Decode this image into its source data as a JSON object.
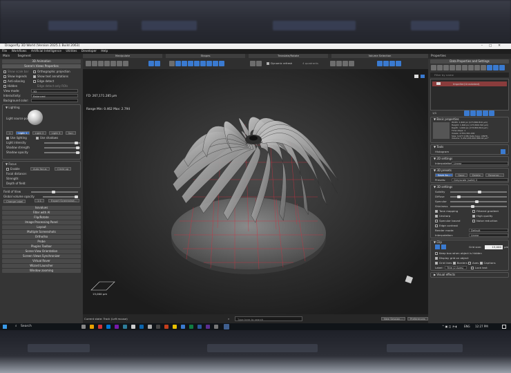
{
  "window": {
    "title": "Dragonfly 3D World (Version 2025.1 Build 2063)",
    "controls": [
      "–",
      "□",
      "✕"
    ]
  },
  "menu": [
    "File",
    "Workflows",
    "Artificial Intelligence",
    "Utilities",
    "Developer",
    "Help"
  ],
  "left_panel": {
    "tabs": [
      "Main",
      "Segment"
    ],
    "section_top": "3D Animation",
    "section_main": "Scene's Views Properties",
    "checks": [
      {
        "label": "Show scale bar",
        "on": false,
        "dim": true
      },
      {
        "label": "Orthographic projection",
        "on": false
      },
      {
        "label": "Show legends",
        "on": false
      },
      {
        "label": "Show text annotations",
        "on": true
      },
      {
        "label": "Anti-aliasing",
        "on": false
      },
      {
        "label": "Edge detect",
        "on": false
      },
      {
        "label": "Hidden",
        "on": false
      },
      {
        "label": "Edge detect only ROIs",
        "on": false,
        "dim": true
      }
    ],
    "view_mode_label": "View mode:",
    "view_mode_value": "3D",
    "interactivity_label": "Interactivity:",
    "interactivity_value": "Balanced",
    "background_color_label": "Background color:",
    "lighting": {
      "title": "Lighting",
      "light_source_label": "Light source position:",
      "light_buttons": [
        "1",
        "Light 1",
        "Light 2",
        "Light 3",
        "Sun"
      ],
      "use_lighting": "Use lighting",
      "use_shadows": "Use shadows",
      "sliders": [
        "Light intensity",
        "Shadow strength",
        "Shadow opacity"
      ]
    },
    "focus": {
      "title": "Focus",
      "enable": "Enable",
      "auto_focus": "Auto focus",
      "circle_up": "Circle up",
      "focal_distance": "Focal distance:",
      "strength": "Strength:",
      "depth_of_field": "Depth of field:"
    },
    "field_of_view": "Field of View",
    "global_volume_opacity": "Global volume opacity",
    "change_label": "Change label",
    "export_screenshot": "Export Screenshot...",
    "sections": [
      "Isovalues",
      "Filter with AI",
      "Flip/Rotate",
      "Image Processing Panel",
      "Layout",
      "Multiple Screenshots",
      "Ortho/Iso",
      "Probe",
      "Plugins Toolbar",
      "Scene View Orientation",
      "Screen Views Synchronizer",
      "Virtual Rover",
      "Wizard Launcher",
      "Window zooming"
    ]
  },
  "toolbar": {
    "groups": [
      "Manipulate",
      "Shapes",
      "Translate/Rotate",
      "Volume Selection"
    ],
    "symmetric_refresh": "Dynamic refresh",
    "quadrants": "4 quadrants"
  },
  "viewport": {
    "fd": "FD: 267,171.285 µm",
    "range": "Range Min: 0.462 Max: 2.794",
    "scale_bar": "15,000 µm"
  },
  "status": {
    "current_state": "Current state: Track (Left mouse)",
    "search_placeholder": "Type here to search",
    "new_session": "New Session...",
    "preferences": "Preferences"
  },
  "right_panel": {
    "title": "Properties",
    "section": "Data Properties and Settings",
    "filter_placeholder": "Filter by name",
    "dataset_name": "Impeller(Unrotated)",
    "count": "1/1",
    "basic_properties": "Basic properties",
    "info_lines": [
      "Width: 1,600 px (173,800.810 µm)",
      "Height: 1,600 px (173,800.310 µm)",
      "Depth: 1,600 px (173,800.810 µm)",
      "Time steps: 1",
      "Voxels: 2,554,301,000",
      "Size: 9,977.0 Mb  Data type: UINT8",
      "Volume: 5,452,003,000,486.02 µm³"
    ],
    "tools": "Tools",
    "histogram": "Histogram",
    "settings_2d": "2D settings",
    "interpolation_label": "Interpolation:",
    "interpolation_value": "Linear",
    "presets_3d": "3D presets",
    "preset_buttons": [
      "Save As...",
      "Save",
      "Delete",
      "Rename..."
    ],
    "presets_label": "Presets:",
    "presets_value": "Greyscale (solid) 2",
    "settings_3d": "3D settings",
    "solidity": "Solidity",
    "diffuse": "Diffuse",
    "specular": "Specular",
    "shininess": "Shininess",
    "checks_3d": [
      {
        "label": "Tone mapping",
        "on": true
      },
      {
        "label": "Filtered gradient",
        "on": false
      },
      {
        "label": "Unsharp",
        "on": true
      },
      {
        "label": "High quality",
        "on": true
      },
      {
        "label": "Specular bound",
        "on": false
      },
      {
        "label": "Noise reduction",
        "on": false
      }
    ],
    "edge_contrast": "Edge contrast",
    "render_mode_label": "Render mode:",
    "render_mode_value": "Default",
    "interp_label": "Interpolation:",
    "interp_value": "Linear",
    "clip": "Clip",
    "grid_size_label": "Grid size:",
    "grid_size_value": "15,000",
    "grid_unit": "µm",
    "keep_box": "Keep box when object is hidden",
    "display_grid": "Display grid on object",
    "grid_lines": "Grid lines",
    "borders": "Borders",
    "axes": "Axes",
    "captions": "Captions",
    "label_label": "Label:",
    "label_value": "Title (2 Axes)",
    "lock_text": "Lock text",
    "visual_effects": "Visual effects"
  },
  "taskbar": {
    "search": "Search",
    "lang": "ENG",
    "time": "12:27 PM"
  },
  "colors": {
    "accent": "#3a7ad0",
    "grid": "#d03040",
    "panel": "#353535"
  }
}
